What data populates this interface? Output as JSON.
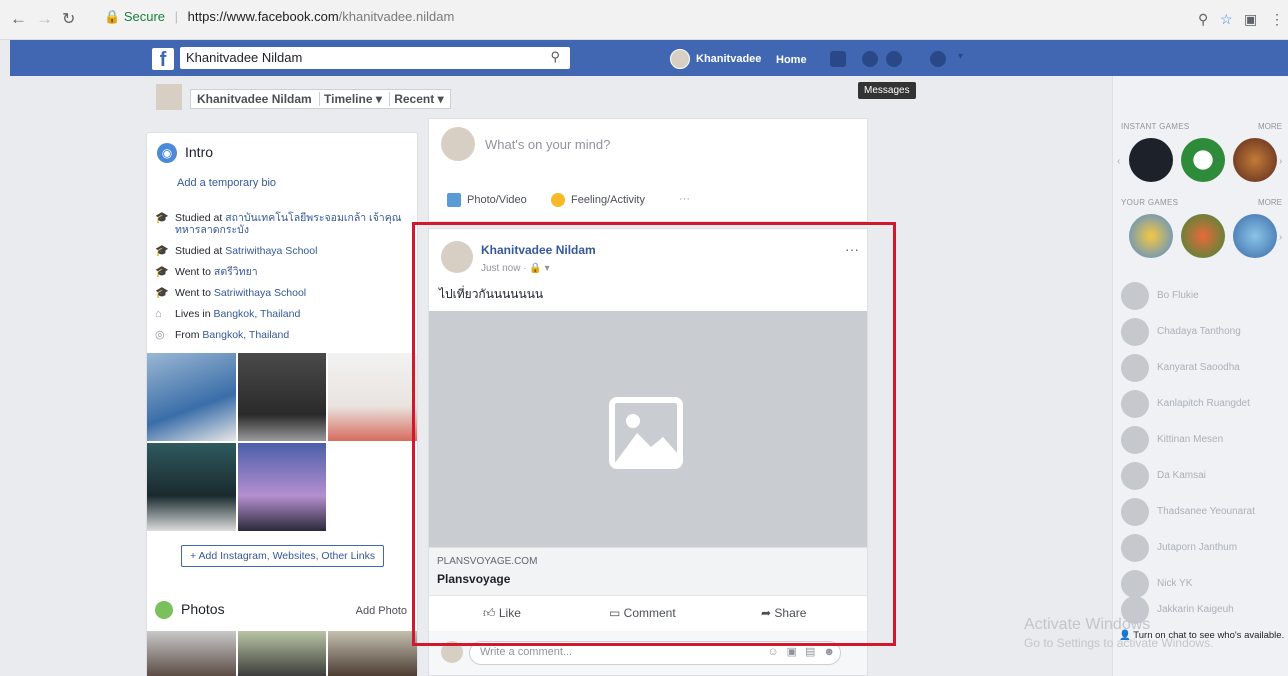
{
  "browser": {
    "secure_label": "Secure",
    "url_host": "https://www.facebook.com",
    "url_path": "/khanitvadee.nildam"
  },
  "topbar": {
    "search_value": "Khanitvadee Nildam",
    "user_name": "Khanitvadee",
    "home_label": "Home",
    "tooltip": "Messages",
    "brand_color": "#4267b2"
  },
  "profile_header": {
    "name": "Khanitvadee Nildam",
    "timeline_label": "Timeline ▾",
    "recent_label": "Recent ▾"
  },
  "intro": {
    "title": "Intro",
    "add_bio": "Add a temporary bio",
    "items": [
      {
        "prefix": "Studied at ",
        "link": "สถาบันเทคโนโลยีพระจอมเกล้า เจ้าคุณทหารลาดกระบัง",
        "icon": "school-icon"
      },
      {
        "prefix": "Studied at ",
        "link": "Satriwithaya School",
        "icon": "school-icon"
      },
      {
        "prefix": "Went to ",
        "link": "สตรีวิทยา",
        "icon": "school-icon"
      },
      {
        "prefix": "Went to ",
        "link": "Satriwithaya School",
        "icon": "school-icon"
      },
      {
        "prefix": "Lives in ",
        "link": "Bangkok, Thailand",
        "icon": "home-icon"
      },
      {
        "prefix": "From ",
        "link": "Bangkok, Thailand",
        "icon": "location-icon"
      }
    ],
    "add_links_label": "+ Add Instagram, Websites, Other Links"
  },
  "photos_section": {
    "title": "Photos",
    "add_photo": "Add Photo"
  },
  "composer": {
    "placeholder": "What's on your mind?",
    "photo_video": "Photo/Video",
    "feeling": "Feeling/Activity",
    "more": "···"
  },
  "post": {
    "author": "Khanitvadee Nildam",
    "meta": "Just now · 🔒 ▾",
    "dots": "···",
    "text": "ไปเที่ยวกันนนนนนน",
    "link_domain": "PLANSVOYAGE.COM",
    "link_title": "Plansvoyage",
    "like": "Like",
    "comment": "Comment",
    "share": "Share",
    "comment_placeholder": "Write a comment..."
  },
  "chat_sidebar": {
    "instant_games": "INSTANT GAMES",
    "your_games": "YOUR GAMES",
    "more": "MORE",
    "contacts": [
      "Bo Flukie",
      "Chadaya Tanthong",
      "Kanyarat Saoodha",
      "Kanlapitch Ruangdet",
      "Kittinan Mesen",
      "Da Kamsai",
      "Thadsanee Yeounarat",
      "Jutaporn Janthum",
      "Nick YK",
      "Jakkarin Kaigeuh"
    ],
    "chat_note": "Turn on chat to see who's available."
  },
  "watermark": {
    "line1": "Activate Windows",
    "line2": "Go to Settings to activate Windows."
  }
}
